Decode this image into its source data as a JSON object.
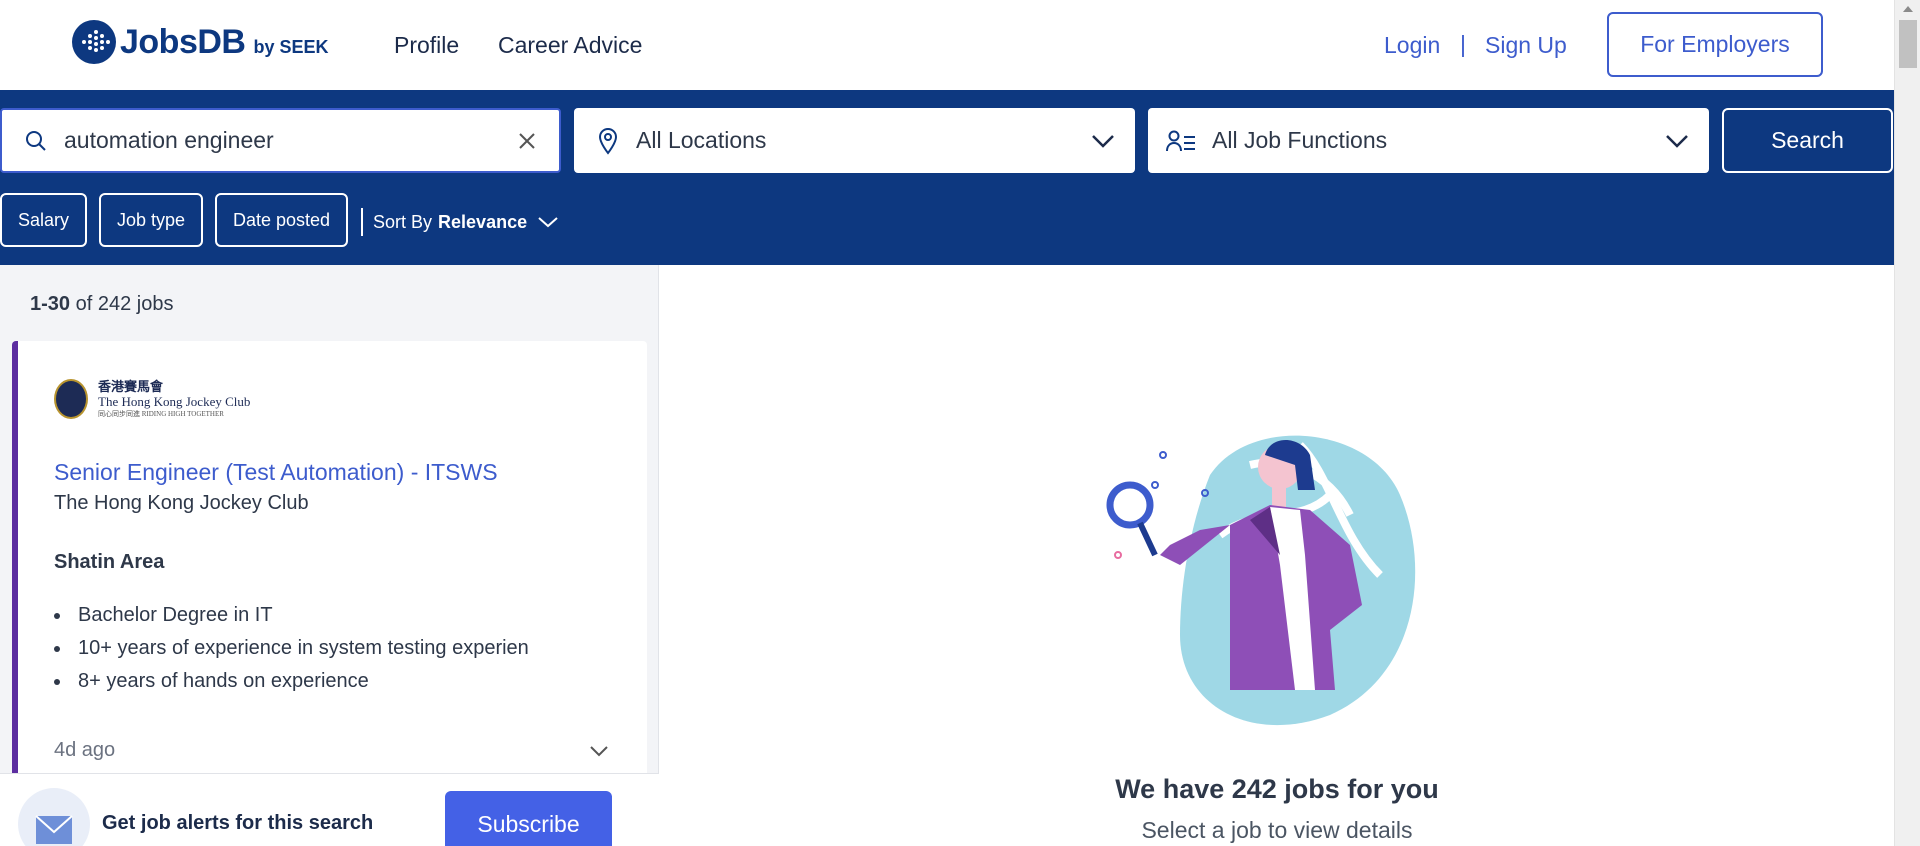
{
  "header": {
    "logo_text": "JobsDB",
    "logo_by": "by SEEK",
    "nav": [
      "Profile",
      "Career Advice"
    ],
    "login": "Login",
    "separator": "|",
    "signup": "Sign Up",
    "employers": "For Employers"
  },
  "search": {
    "keyword": "automation engineer",
    "location": "All Locations",
    "function": "All Job Functions",
    "button": "Search"
  },
  "filters": {
    "salary": "Salary",
    "job_type": "Job type",
    "date_posted": "Date posted",
    "sort_label": "Sort By",
    "sort_value": "Relevance"
  },
  "results": {
    "range": "1-30",
    "total_text": "of 242 jobs"
  },
  "job": {
    "logo_zh": "香港賽馬會",
    "logo_en": "The Hong Kong Jockey Club",
    "logo_tag": "同心同步同進 RIDING HIGH TOGETHER",
    "title": "Senior Engineer (Test Automation) - ITSWS",
    "company": "The Hong Kong Jockey Club",
    "location": "Shatin Area",
    "bullets": [
      "Bachelor Degree in IT",
      "10+ years of experience in system testing experien",
      "8+ years of hands on experience"
    ],
    "posted": "4d ago"
  },
  "alert": {
    "text": "Get job alerts for this search",
    "button": "Subscribe"
  },
  "empty_state": {
    "headline": "We have 242 jobs for you",
    "subtext": "Select a job to view details"
  },
  "colors": {
    "brand_navy": "#0d3880",
    "link_blue": "#3d5ccd",
    "accent_purple": "#5c2da0",
    "subscribe_blue": "#4461e6"
  }
}
